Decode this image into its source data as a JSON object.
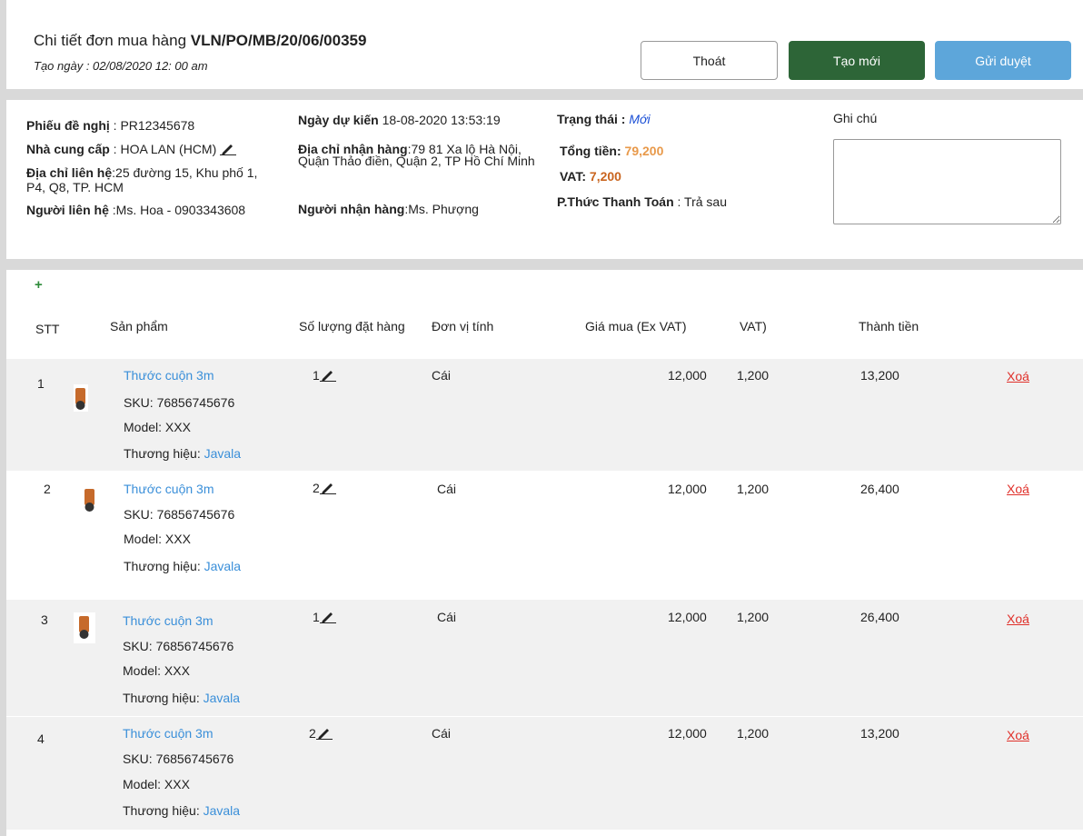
{
  "header": {
    "title_prefix": "Chi tiết đơn mua hàng ",
    "po_code": "VLN/PO/MB/20/06/00359",
    "created": "Tạo ngày : 02/08/2020 12: 00 am",
    "buttons": {
      "exit": "Thoát",
      "new": "Tạo mới",
      "submit": "Gửi duyệt"
    }
  },
  "info": {
    "request_label": "Phiếu đề nghị",
    "request_value": " : PR12345678",
    "supplier_label": "Nhà cung cấp",
    "supplier_value": " : HOA LAN (HCM)",
    "contact_addr_label": "Địa chỉ liên hệ",
    "contact_addr_value": ":25 đường 15, Khu phố 1, P4, Q8, TP. HCM",
    "contact_person_label": "Người liên hệ",
    "contact_person_value": " :Ms. Hoa - 0903343608",
    "expected_date_label": "Ngày dự kiến",
    "expected_date_value": " 18-08-2020 13:53:19",
    "ship_addr_label": "Địa chỉ nhận hàng",
    "ship_addr_value": ":79 81 Xa lộ Hà Nội, Quận Thảo điền, Quận 2, TP Hồ Chí Minh",
    "receiver_label": "Người nhận hàng",
    "receiver_value": ":Ms. Phượng",
    "status_label": "Trạng thái :",
    "status_value": "Mới",
    "total_label": "Tổng tiền: ",
    "total_value": "79,200",
    "vat_label": "VAT: ",
    "vat_value": "7,200",
    "payment_label": "P.Thức Thanh Toán",
    "payment_value": " : Trả sau",
    "note_label": "Ghi chú",
    "note_value": ""
  },
  "table": {
    "add_symbol": "+",
    "headers": [
      "STT",
      "Sản phẩm",
      "Số lượng đặt hàng",
      "Đơn vị tính",
      "Giá mua (Ex VAT)",
      "VAT)",
      "Thành tiền"
    ],
    "sku_label": "SKU: ",
    "model_label": "Model: ",
    "brand_label": "Thương hiệu: ",
    "delete_label": "Xoá",
    "rows": [
      {
        "stt": "1",
        "name": "Thước cuộn 3m",
        "sku": "76856745676",
        "model": "XXX",
        "brand": "Javala",
        "qty": "1",
        "unit": "Cái",
        "price": "12,000",
        "vat": "1,200",
        "total": "13,200"
      },
      {
        "stt": "2",
        "name": "Thước cuộn 3m",
        "sku": "76856745676",
        "model": "XXX",
        "brand": "Javala",
        "qty": "2",
        "unit": "Cái",
        "price": "12,000",
        "vat": "1,200",
        "total": "26,400"
      },
      {
        "stt": "3",
        "name": "Thước cuộn 3m",
        "sku": "76856745676",
        "model": "XXX",
        "brand": "Javala",
        "qty": "1",
        "unit": "Cái",
        "price": "12,000",
        "vat": "1,200",
        "total": "26,400"
      },
      {
        "stt": "4",
        "name": "Thước cuộn 3m",
        "sku": "76856745676",
        "model": "XXX",
        "brand": "Javala",
        "qty": "2",
        "unit": "Cái",
        "price": "12,000",
        "vat": "1,200",
        "total": "13,200"
      }
    ]
  },
  "colors": {
    "accent_green": "#2d6537",
    "accent_blue": "#5da6da",
    "link": "#3a8fd9",
    "delete": "#e0302a",
    "total": "#e8994a",
    "vat": "#c9641e"
  }
}
